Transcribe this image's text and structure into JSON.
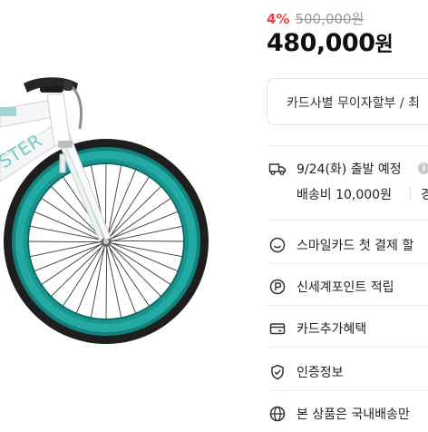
{
  "product": {
    "image_alt": "Teal rim fixed-gear bicycle (front wheel)",
    "frame_lettering": "STER",
    "discount_rate": "4%",
    "original_price": "500,000원",
    "sale_price": "480,000",
    "sale_price_unit": "원"
  },
  "installment": {
    "label": "카드사별 무이자할부 / 최"
  },
  "shipping": {
    "icon": "truck-icon",
    "date_label": "9/24(화) 출발 예정",
    "fee_label": "배송비 10,000원",
    "fee_more": "경"
  },
  "benefits": [
    {
      "icon": "smile-icon",
      "label": "스마일카드 첫 결제 할"
    },
    {
      "icon": "point-p-icon",
      "label": "신세계포인트 적립"
    },
    {
      "icon": "card-icon",
      "label": "카드추가혜택"
    },
    {
      "icon": "shield-check-icon",
      "label": "인증정보"
    },
    {
      "icon": "globe-icon",
      "label": "본 상품은 국내배송만"
    }
  ],
  "colors": {
    "discount": "#ff3b3b",
    "rim": "#1a9a95",
    "tire": "#1e1e1e",
    "frame": "#f4f6f7"
  }
}
